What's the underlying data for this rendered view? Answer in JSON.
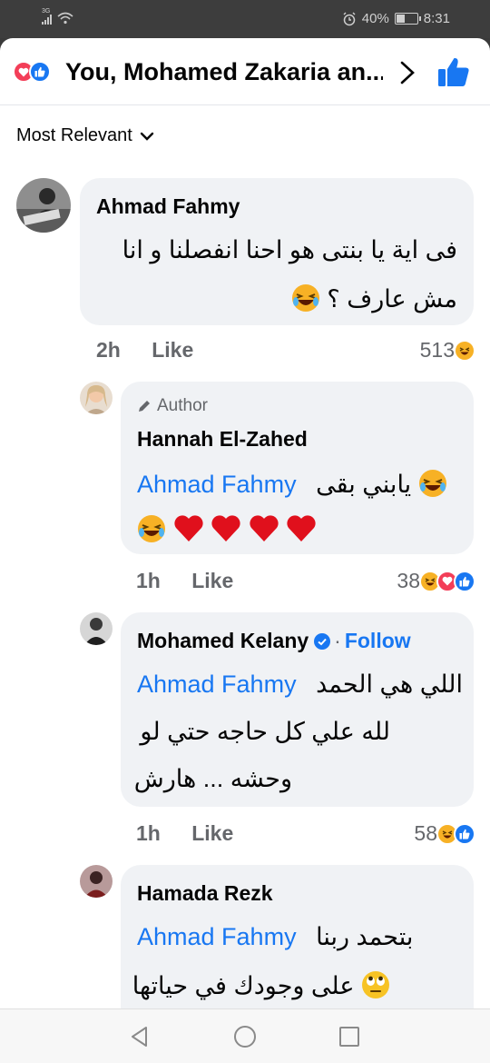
{
  "status_bar": {
    "network": "3G",
    "battery_percent": "40%",
    "battery_level": 0.4,
    "time": "8:31"
  },
  "header": {
    "title": "You, Mohamed Zakaria an...",
    "reaction_icons": [
      "heart-icon",
      "like-icon"
    ],
    "chevron_icon": "chevron-right-icon",
    "like_button_icon": "thumbs-up-icon"
  },
  "sort": {
    "label": "Most Relevant",
    "icon": "chevron-down-icon"
  },
  "comments": [
    {
      "author": "Ahmad Fahmy",
      "lines": [
        "ﻓﻰ اية يا بنتى هو احنا انفصلنا و انا",
        "مش عارف ؟"
      ],
      "emoji": "😂",
      "time": "2h",
      "like_label": "Like",
      "reaction_count": "513",
      "reactions": [
        "haha"
      ]
    },
    {
      "badge": "Author",
      "author": "Hannah El-Zahed",
      "tag": "Ahmad Fahmy",
      "text": "يابني بقى",
      "emoji_line": "😂❤️❤️❤️❤️",
      "time": "1h",
      "like_label": "Like",
      "reaction_count": "38",
      "reactions": [
        "haha",
        "love",
        "like"
      ]
    },
    {
      "author": "Mohamed Kelany",
      "follow_label": "Follow",
      "tag": "Ahmad Fahmy",
      "line1": "اللي هي الحمد",
      "line2": "لله علي كل حاجه حتي لو",
      "line3": "وحشه ... هارش",
      "time": "1h",
      "like_label": "Like",
      "reaction_count": "58",
      "reactions": [
        "haha",
        "like"
      ]
    },
    {
      "author": "Hamada Rezk",
      "tag": "Ahmad Fahmy",
      "line1": "بتحمد ربنا",
      "line2": "على وجودك في حياتها",
      "emoji": "🙄"
    }
  ],
  "nav": {
    "back_icon": "back-triangle-icon",
    "home_icon": "home-circle-icon",
    "recent_icon": "recent-square-icon"
  },
  "colors": {
    "accent": "#1877f2",
    "love": "#f33e58",
    "haha": "#f7b125",
    "bubble": "#f0f2f5",
    "secondary_text": "#65676b"
  }
}
